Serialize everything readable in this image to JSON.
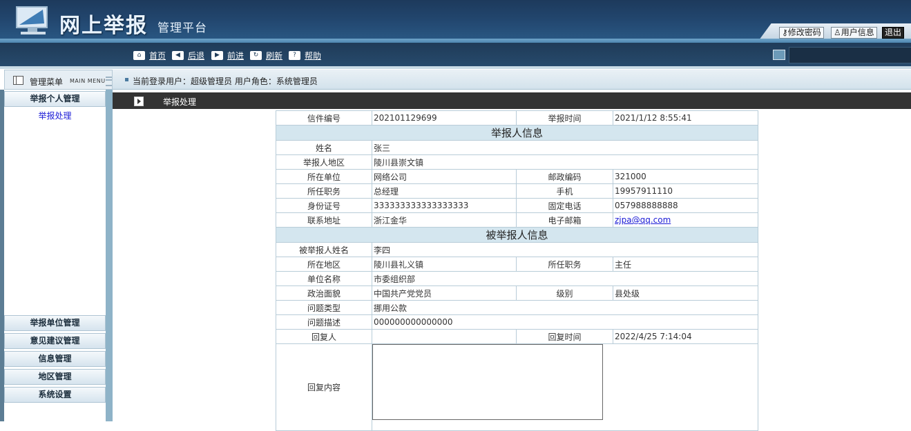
{
  "header": {
    "logo_title": "网上举报",
    "logo_subtitle": "管理平台",
    "buttons": {
      "change_password": "修改密码",
      "user_info": "用户信息",
      "logout": "退出"
    }
  },
  "nav": {
    "home": "首页",
    "back": "后退",
    "forward": "前进",
    "refresh": "刷新",
    "help": "帮助"
  },
  "sidebar": {
    "title": "管理菜单",
    "title_en": "MAIN MENU",
    "groups": [
      {
        "label": "举报个人管理",
        "items": [
          "举报处理"
        ]
      },
      {
        "label": "举报单位管理"
      },
      {
        "label": "意见建议管理"
      },
      {
        "label": "信息管理"
      },
      {
        "label": "地区管理"
      },
      {
        "label": "系统设置"
      }
    ]
  },
  "status": {
    "text": "当前登录用户：超级管理员  用户角色：系统管理员"
  },
  "content": {
    "title": "举报处理",
    "form": {
      "letter_no_label": "信件编号",
      "letter_no": "202101129699",
      "report_time_label": "举报时间",
      "report_time": "2021/1/12 8:55:41",
      "reporter_section": "举报人信息",
      "name_label": "姓名",
      "name": "张三",
      "region_label": "举报人地区",
      "region": "陵川县崇文镇",
      "unit_label": "所在单位",
      "unit": "网络公司",
      "postcode_label": "邮政编码",
      "postcode": "321000",
      "position_label": "所任职务",
      "position": "总经理",
      "mobile_label": "手机",
      "mobile": "19957911110",
      "idcard_label": "身份证号",
      "idcard": "333333333333333333",
      "phone_label": "固定电话",
      "phone": "057988888888",
      "address_label": "联系地址",
      "address": "浙江金华",
      "email_label": "电子邮箱",
      "email": "zjpa@qq.com",
      "accused_section": "被举报人信息",
      "accused_name_label": "被举报人姓名",
      "accused_name": "李四",
      "accused_region_label": "所在地区",
      "accused_region": "陵川县礼义镇",
      "accused_position_label": "所任职务",
      "accused_position": "主任",
      "accused_unit_label": "单位名称",
      "accused_unit": "市委组织部",
      "political_label": "政治面貌",
      "political": "中国共产党党员",
      "level_label": "级别",
      "level": "县处级",
      "issue_type_label": "问题类型",
      "issue_type": "挪用公款",
      "issue_desc_label": "问题描述",
      "issue_desc": "000000000000000",
      "replier_label": "回复人",
      "replier": "",
      "reply_time_label": "回复时间",
      "reply_time": "2022/4/25 7:14:04",
      "reply_content_label": "回复内容",
      "reply_content": ""
    }
  }
}
